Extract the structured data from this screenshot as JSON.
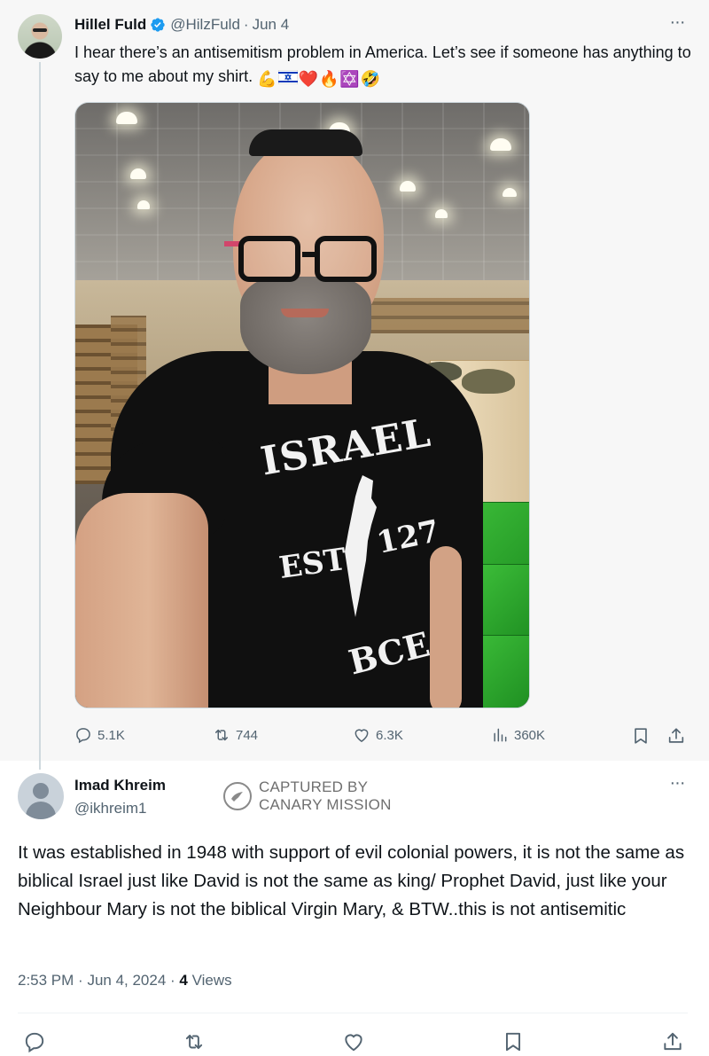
{
  "tweet": {
    "author_name": "Hillel Fuld",
    "author_handle": "@HilzFuld",
    "date": "Jun 4",
    "text": "I hear there’s an antisemitism problem in America. Let’s see if someone has anything to say to me about my shirt.",
    "emojis": [
      "💪",
      "🇮🇱",
      "❤️",
      "🔥",
      "✡️",
      "🤣"
    ],
    "image_shirt_text": {
      "line1": "ISRAEL",
      "est": "EST",
      "year": "127",
      "era": "BCE"
    },
    "stats": {
      "replies": "5.1K",
      "retweets": "744",
      "likes": "6.3K",
      "views": "360K"
    }
  },
  "reply": {
    "author_name": "Imad Khreim",
    "author_handle": "@ikhreim1",
    "watermark_line1": "CAPTURED BY",
    "watermark_line2": "CANARY MISSION",
    "text": "It was established in 1948 with support of evil colonial powers, it is not the same as biblical Israel just like David is not the same as king/ Prophet David, just like your Neighbour Mary is not the biblical Virgin Mary, & BTW..this is not antisemitic",
    "time": "2:53 PM",
    "date": "Jun 4, 2024",
    "views_count": "4",
    "views_label": "Views"
  },
  "icons": {
    "verified": "verified-badge-icon",
    "more": "more-options-icon",
    "reply": "reply-icon",
    "retweet": "retweet-icon",
    "like": "heart-icon",
    "views": "views-chart-icon",
    "bookmark": "bookmark-icon",
    "share": "share-icon"
  },
  "colors": {
    "text_primary": "#0f1419",
    "text_secondary": "#536471",
    "verified_blue": "#1d9bf0",
    "parent_background": "#f7f7f7"
  }
}
